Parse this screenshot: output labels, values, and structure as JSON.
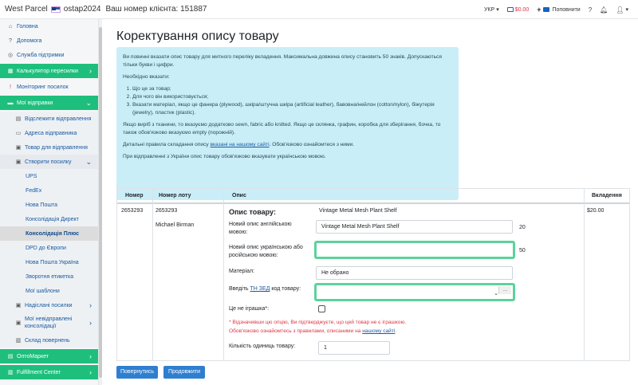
{
  "header": {
    "brand": "West Parcel",
    "username": "ostap2024",
    "client_label": "Ваш номер клієнта: 151887",
    "lang": "УКР",
    "balance": "$0.00",
    "topup": "Поповнити"
  },
  "sidebar": {
    "home": "Головна",
    "help": "Допомога",
    "support": "Служба підтримки",
    "calculator": "Калькулятор пересилки",
    "monitoring": "Моніторинг посилок",
    "my_shipments": "Мої відправки",
    "track": "Відслежити відправлення",
    "sender_address": "Адреса відправника",
    "goods": "Товар для відправлення",
    "create": "Створити посилку",
    "carriers": [
      "UPS",
      "FedEx",
      "Нова Пошта",
      "Консолідація Директ",
      "Консолідація Плюс",
      "DPD до Європи",
      "Нова Пошта Україна",
      "Зворотня етикетка",
      "Мої шаблони"
    ],
    "sent": "Надіслані посилки",
    "unsent_consolidations": "Мої невідправлені консолідації",
    "returns_warehouse": "Склад повернень",
    "optomarket": "ОптоМаркет",
    "fulfillment": "Fulfillment Center"
  },
  "page": {
    "title": "Коректування опису товару",
    "info": {
      "p1": "Ви повинні вказати опис товару для митного переліку вкладення. Максимальна довжина опису становить 50 знаків. Допускаються тільки букви і цифри.",
      "p2": "Необхідно вказати:",
      "list": [
        "Що це за товар;",
        "Для чого він використовується;",
        "Вказати матеріал, якщо це фанера (plywood), шкіра/штучна шкіра (artificial leather), бавовна/нейлон (cotton/nylon), біжутерія (jewelry), пластик (plastic)."
      ],
      "p3": "Якщо виріб з тканини, то вказуємо додатково sewn, fabric або knitted. Якщо це склянка, графин, коробка для зберігання, бочка, то також обов'язково вказуємо empty (порожній).",
      "p4_pre": "Детальні правила складання опису ",
      "p4_link": "вказані на нашому сайті",
      "p4_post": ". Обов'язково ознайомтеся з ними.",
      "p5": "При відправленні з України опис товару обов'язково вказувати українською мовою."
    },
    "table": {
      "headers": [
        "Номер",
        "Номер лоту",
        "Опис",
        "Вкладення"
      ],
      "row": {
        "number": "2653293",
        "lot": "2653293",
        "name": "Michael Birman",
        "desc_title": "Опис товару:",
        "desc_value": "Vintage Metal Mesh Plant Shelf",
        "amount": "$20.00"
      }
    },
    "form": {
      "new_en_label": "Новий опис англійською мовою:",
      "new_en_value": "Vintage Metal Mesh Plant Shelf",
      "new_en_count": "20",
      "new_ua_label": "Новий опис українською або російською мовою:",
      "new_ua_value": "",
      "new_ua_count": "50",
      "material_label": "Матеріал:",
      "material_value": "Не обрано",
      "hs_label_pre": "Введіть ",
      "hs_label_link": "ТН ЗЕД",
      "hs_label_post": " код товару:",
      "hs_value": "",
      "hs_button": "...",
      "toy_label": "Це не іграшка*:",
      "warn_line1": "* Відзначивши цю опцію, Ви підтверджуєте, що цей товар не є іграшкою.",
      "warn_line2_pre": "Обов'язково ознайомтесь з правилами, описаними на ",
      "warn_line2_link": "нашому сайті",
      "warn_line2_post": ".",
      "qty_label": "Кількість одиниць товару:",
      "qty_value": "1"
    },
    "buttons": {
      "back": "Повернутись",
      "continue": "Продовжити"
    }
  },
  "colors": {
    "green": "#1ebf7d",
    "info_bg": "#c9eef8",
    "primary": "#2f7fd0",
    "danger": "#dc3545"
  }
}
